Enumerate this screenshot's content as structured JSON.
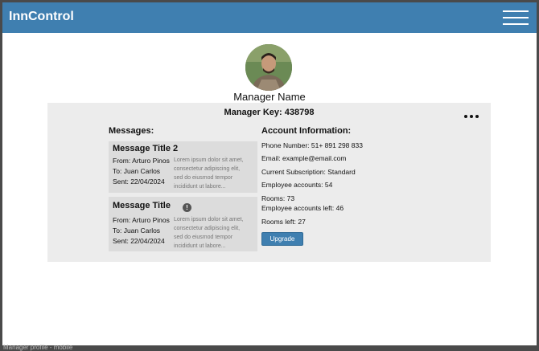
{
  "app": {
    "title": "InnControl"
  },
  "profile": {
    "name": "Manager Name",
    "manager_key": "Manager Key: 438798"
  },
  "messages": {
    "heading": "Messages:",
    "items": [
      {
        "title": "Message Title 2",
        "from": "From: Arturo Pinos",
        "to": "To: Juan Carlos",
        "sent": "Sent: 22/04/2024",
        "preview_lines": [
          "Lorem ipsum dolor sit amet,",
          "consectetur adipiscing elit,",
          "sed do eiusmod tempor",
          "incididunt ut labore..."
        ],
        "alert": false
      },
      {
        "title": "Message Title",
        "from": "From: Arturo Pinos",
        "to": "To: Juan Carlos",
        "sent": "Sent: 22/04/2024",
        "preview_lines": [
          "Lorem ipsum dolor sit amet,",
          "consectetur adipiscing elit,",
          "sed do eiusmod tempor",
          "incididunt ut labore..."
        ],
        "alert": true
      }
    ]
  },
  "account": {
    "heading": "Account Information:",
    "phone": "Phone Number: 51+ 891 298 833",
    "email": "Email: example@email.com",
    "subscription": "Current Subscription: Standard",
    "employee_accounts": "Employee accounts: 54",
    "rooms": "Rooms: 73",
    "employee_accounts_left": "Employee accounts left: 46",
    "rooms_left": "Rooms left: 27",
    "upgrade_label": "Upgrade"
  },
  "icons": {
    "menu": "hamburger-menu-icon",
    "more": "more-options-icon",
    "alert": "alert-icon",
    "avatar": "manager-avatar"
  },
  "colors": {
    "brand": "#3f7fb0",
    "panel": "#ececec",
    "card": "#dcdcdc"
  },
  "footer": {
    "label": "Manager profile - mobile"
  }
}
